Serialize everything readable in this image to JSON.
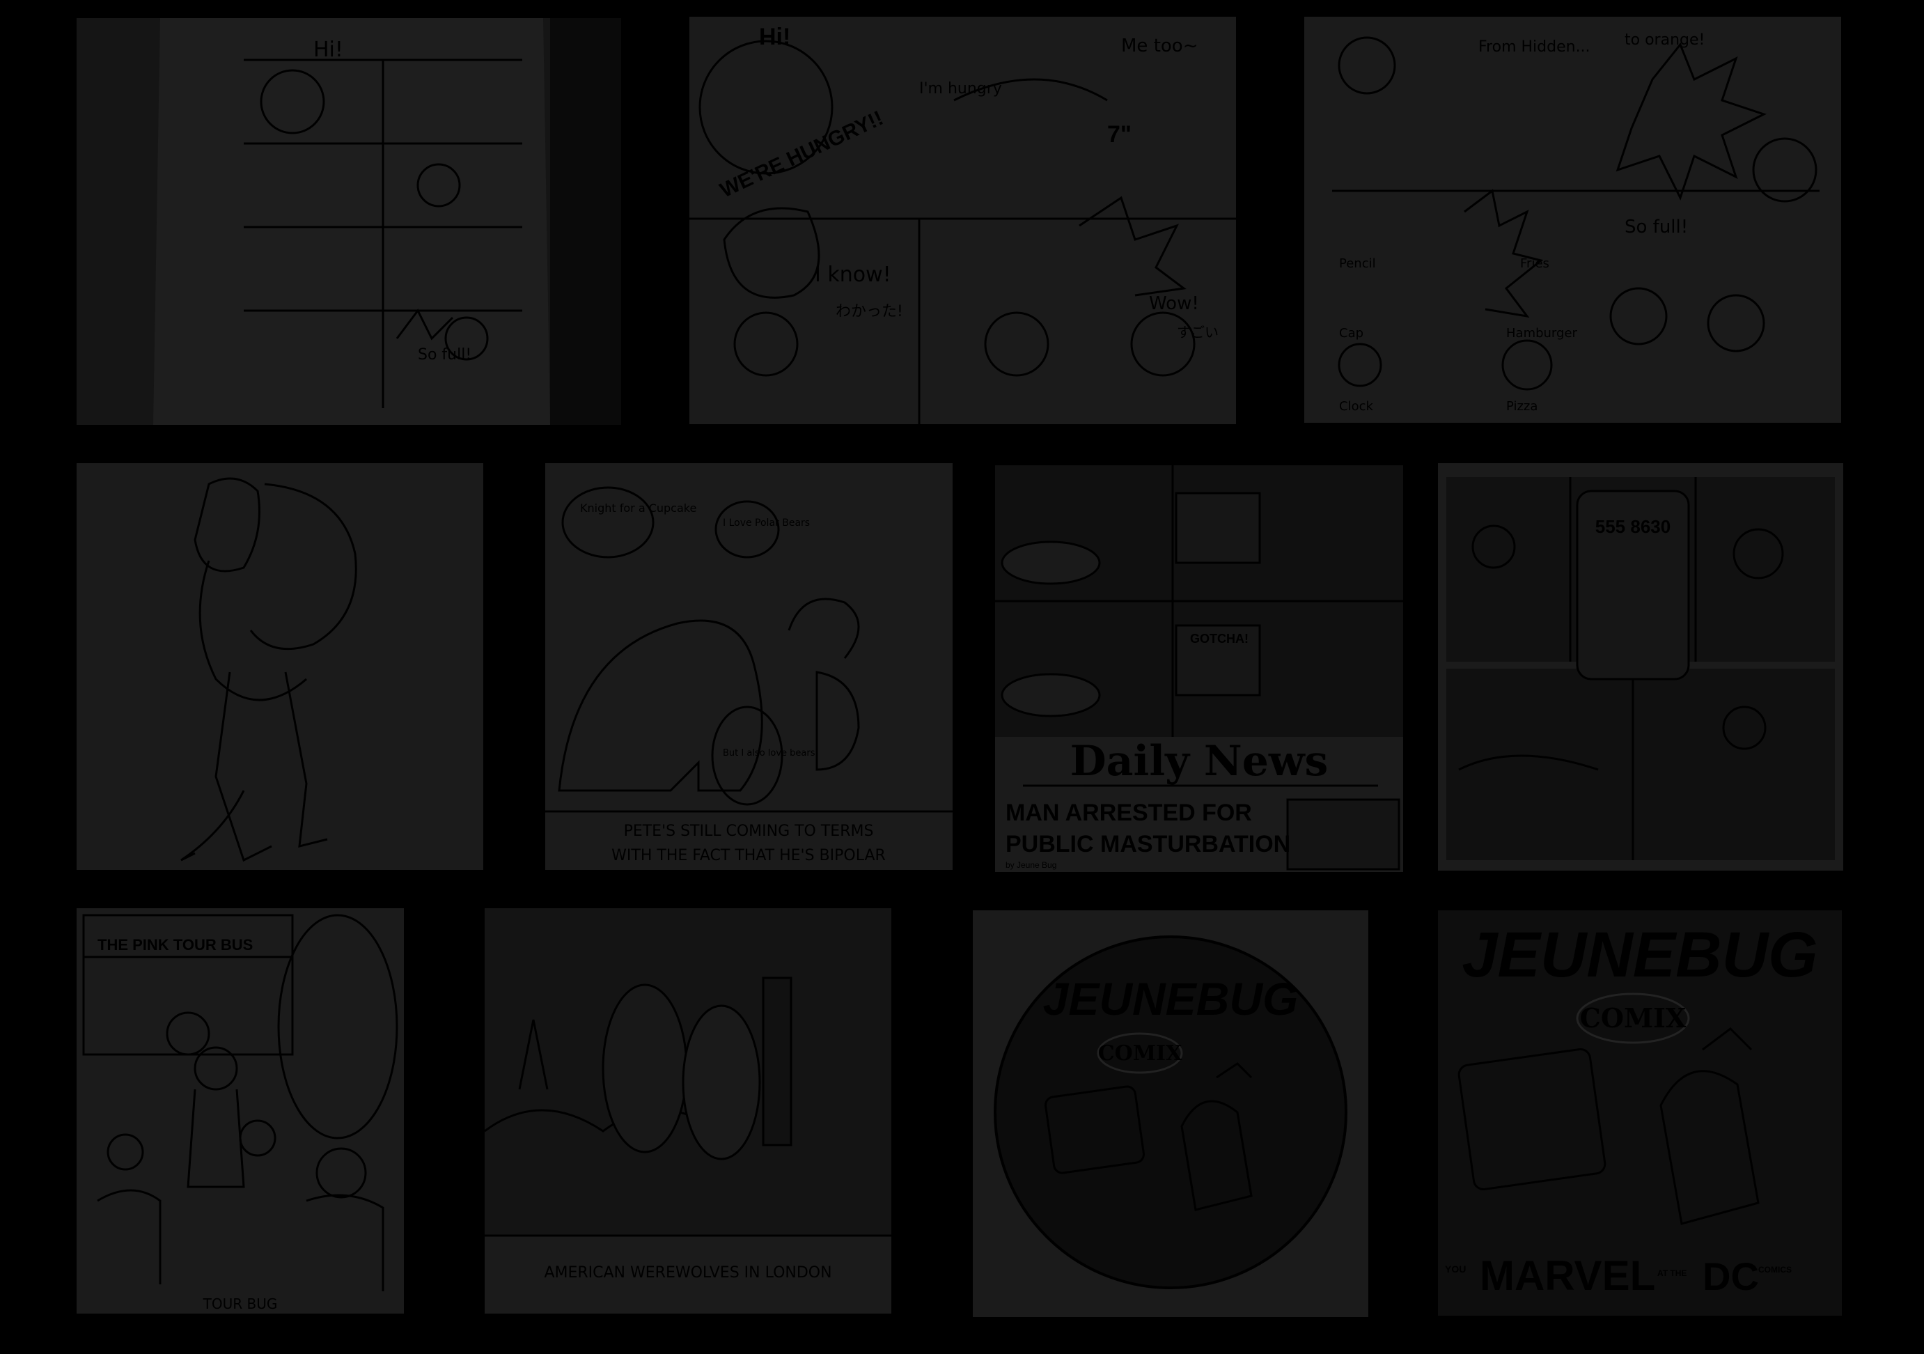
{
  "gallery": {
    "tiles": [
      {
        "id": "doraemon-photo",
        "texts": {
          "hi": "Hi!",
          "so_full": "So full!"
        }
      },
      {
        "id": "doraemon-hungry",
        "texts": {
          "hi": "Hi!",
          "banner": "WE'RE HUNGRY!!",
          "im_hungry": "I'm hungry",
          "me_too": "Me too~",
          "seven": "7\"",
          "i_know": "I know!",
          "jp_know": "わかった!",
          "wow": "Wow!",
          "jp_wow": "すごい"
        }
      },
      {
        "id": "doraemon-transform",
        "texts": {
          "from": "From Hidden...",
          "to": "to orange!",
          "so_full": "So full!",
          "pencil": "Pencil",
          "cap": "Cap",
          "clock": "Clock",
          "fries": "Fries",
          "hamburger": "Hamburger",
          "pizza": "Pizza"
        }
      },
      {
        "id": "monster-drawing",
        "texts": {}
      },
      {
        "id": "polar-bear-comic",
        "texts": {
          "bubble1": "Knight for a Cupcake",
          "bubble2": "I Love Polar Bears",
          "bubble3": "But I also love bears",
          "caption1": "PETE'S STILL COMING TO TERMS",
          "caption2": "WITH THE FACT THAT HE'S BIPOLAR"
        }
      },
      {
        "id": "daily-news-comic",
        "texts": {
          "newspaper": "Daily News",
          "headline1": "MAN ARRESTED FOR",
          "headline2": "PUBLIC MASTURBATION",
          "gotcha": "GOTCHA!",
          "byline": "by Jeune Bug"
        }
      },
      {
        "id": "phone-photo-comic",
        "texts": {
          "phone_number": "555 8630"
        }
      },
      {
        "id": "tour-bus-comic",
        "texts": {
          "bus": "THE PINK TOUR BUS",
          "caption": "TOUR BUG"
        }
      },
      {
        "id": "werewolves-comic",
        "texts": {
          "caption": "AMERICAN WEREWOLVES IN LONDON"
        }
      },
      {
        "id": "jeunebug-circle-logo",
        "texts": {
          "title": "JEUNEBUG",
          "subtitle": "COMIX"
        }
      },
      {
        "id": "jeunebug-poster",
        "texts": {
          "title": "JEUNEBUG",
          "subtitle": "COMIX",
          "you": "YOU",
          "marvel": "MARVEL",
          "at_the": "AT THE",
          "dc": "DC",
          "comics": "COMICS"
        }
      }
    ]
  }
}
